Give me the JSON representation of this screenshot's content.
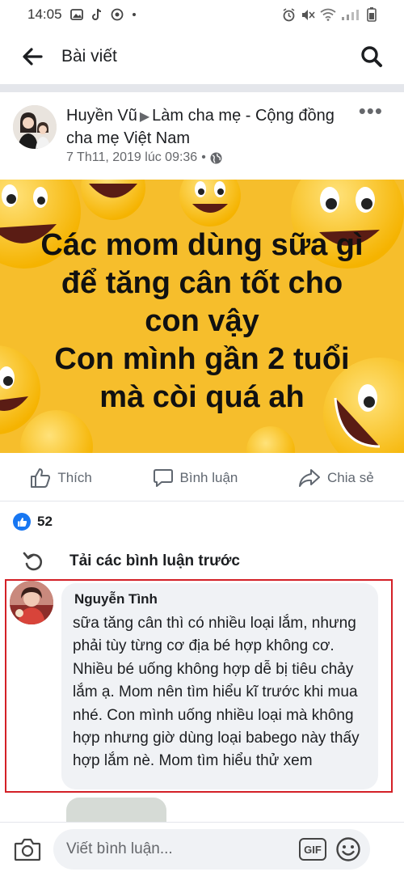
{
  "status_bar": {
    "time": "14:05"
  },
  "app_bar": {
    "title": "Bài viết"
  },
  "post": {
    "author": "Huyền Vũ",
    "group": "Làm cha mẹ - Cộng đồng cha mẹ Việt Nam",
    "timestamp": "7 Th11, 2019 lúc 09:36",
    "dot": "•",
    "image_lines": [
      "Các mom dùng sữa gì",
      "để tăng cân tốt cho",
      "con vậy",
      "Con mình gần 2 tuổi",
      "mà còi quá ah"
    ],
    "reaction_count": "52"
  },
  "actions": {
    "like": "Thích",
    "comment": "Bình luận",
    "share": "Chia sẻ"
  },
  "comments": {
    "load_previous": "Tải các bình luận trước",
    "items": [
      {
        "author": "Nguyễn Tình",
        "text": "sữa tăng cân thì có nhiều loại lắm, nhưng phải tùy từng cơ địa bé hợp không cơ. Nhiều bé uống không hợp dễ bị tiêu chảy lắm ạ. Mom nên tìm hiểu kĩ trước khi mua nhé. Con mình uống nhiều loại mà không hợp nhưng giờ dùng loại babego này thấy hợp lắm nè. Mom tìm hiểu thử xem"
      }
    ]
  },
  "composer": {
    "placeholder": "Viết bình luận...",
    "gif_label": "GIF"
  },
  "colors": {
    "accent": "#1877f2",
    "highlight_border": "#d42027",
    "image_bg": "#f6be2c"
  },
  "icons": [
    "back-arrow-icon",
    "search-icon",
    "more-icon",
    "globe-icon",
    "like-icon",
    "comment-icon",
    "share-icon",
    "refresh-icon",
    "camera-icon",
    "emoji-icon"
  ]
}
